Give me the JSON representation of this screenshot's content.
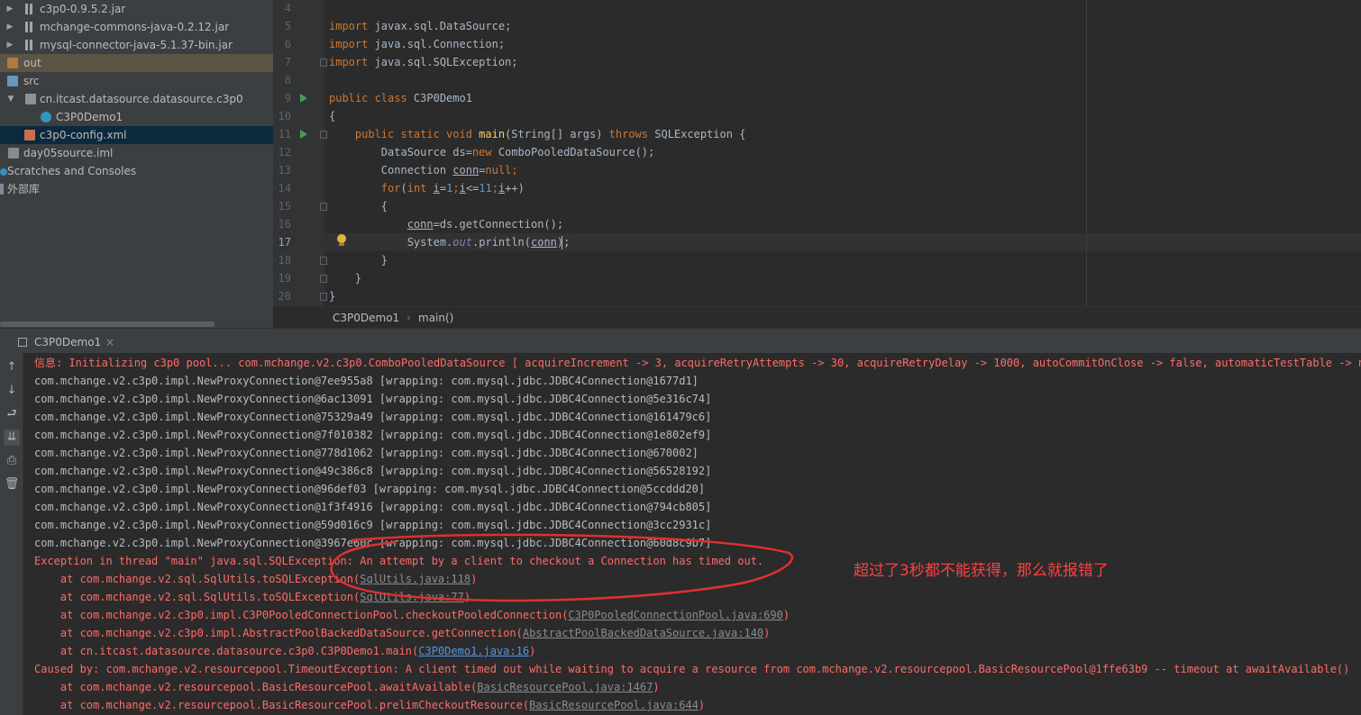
{
  "project_tree": {
    "items": [
      {
        "label": "c3p0-0.9.5.2.jar",
        "icon": "jar-icon"
      },
      {
        "label": "mchange-commons-java-0.2.12.jar",
        "icon": "jar-icon"
      },
      {
        "label": "mysql-connector-java-5.1.37-bin.jar",
        "icon": "jar-icon"
      },
      {
        "label": "out",
        "icon": "folder-icon"
      },
      {
        "label": "src",
        "icon": "folder-icon"
      },
      {
        "label": "cn.itcast.datasource.datasource.c3p0",
        "icon": "package-icon"
      },
      {
        "label": "C3P0Demo1",
        "icon": "class-icon"
      },
      {
        "label": "c3p0-config.xml",
        "icon": "xml-file-icon"
      },
      {
        "label": "day05source.iml",
        "icon": "iml-file-icon"
      },
      {
        "label": "Scratches and Consoles",
        "icon": "scratches-icon"
      },
      {
        "label": "外部库",
        "icon": "external-libraries-icon"
      }
    ]
  },
  "editor": {
    "line_numbers": [
      "4",
      "5",
      "6",
      "7",
      "8",
      "9",
      "10",
      "11",
      "12",
      "13",
      "14",
      "15",
      "16",
      "17",
      "18",
      "19",
      "20"
    ],
    "current_line": "17",
    "code": {
      "l5_kw": "import",
      "l5_rest": " javax.sql.DataSource;",
      "l6_kw": "import",
      "l6_rest": " java.sql.Connection;",
      "l7_kw": "import",
      "l7_rest": " java.sql.SQLException;",
      "l9_kw": "public class",
      "l9_rest": " C3P0Demo1",
      "l10": "{",
      "l11_kw1": "    public static void",
      "l11_fn": " main",
      "l11_mid": "(String[] args) ",
      "l11_kw2": "throws",
      "l11_rest": " SQLException {",
      "l12_a": "        DataSource ds=",
      "l12_kw": "new",
      "l12_b": " ComboPooledDataSource();",
      "l13_a": "        Connection ",
      "l13_var": "conn",
      "l13_b": "=",
      "l13_kw": "null",
      "l13_c": ";",
      "l14_ind": "        ",
      "l14_kw1": "for",
      "l14_b": "(",
      "l14_kw2": "int",
      "l14_c": " ",
      "l14_i1": "i",
      "l14_d": "=",
      "l14_n1": "1",
      "l14_e": ";",
      "l14_i2": "i",
      "l14_f": "<=",
      "l14_n2": "11",
      "l14_g": ";",
      "l14_i3": "i",
      "l14_h": "++)",
      "l15": "        {",
      "l16_ind": "            ",
      "l16_var": "conn",
      "l16_rest": "=ds.getConnection();",
      "l17_a": "            System.",
      "l17_out": "out",
      "l17_b": ".println(",
      "l17_var": "conn",
      "l17_c": ");",
      "l18": "        }",
      "l19": "    }",
      "l20": "}"
    }
  },
  "breadcrumb": {
    "class": "C3P0Demo1",
    "separator": "›",
    "method": "main()"
  },
  "run_window": {
    "tab_label": "C3P0Demo1",
    "close": "×"
  },
  "toolbar": {
    "up": "↑",
    "down": "↓",
    "wrap": "⮐",
    "scroll_end": "⇊",
    "print": "⎙",
    "trash": "🗑"
  },
  "console": {
    "info_line": "信息: Initializing c3p0 pool... com.mchange.v2.c3p0.ComboPooledDataSource [ acquireIncrement -> 3, acquireRetryAttempts -> 30, acquireRetryDelay -> 1000, autoCommitOnClose -> false, automaticTestTable -> null, b",
    "conn_lines": [
      "com.mchange.v2.c3p0.impl.NewProxyConnection@7ee955a8 [wrapping: com.mysql.jdbc.JDBC4Connection@1677d1]",
      "com.mchange.v2.c3p0.impl.NewProxyConnection@6ac13091 [wrapping: com.mysql.jdbc.JDBC4Connection@5e316c74]",
      "com.mchange.v2.c3p0.impl.NewProxyConnection@75329a49 [wrapping: com.mysql.jdbc.JDBC4Connection@161479c6]",
      "com.mchange.v2.c3p0.impl.NewProxyConnection@7f010382 [wrapping: com.mysql.jdbc.JDBC4Connection@1e802ef9]",
      "com.mchange.v2.c3p0.impl.NewProxyConnection@778d1062 [wrapping: com.mysql.jdbc.JDBC4Connection@670002]",
      "com.mchange.v2.c3p0.impl.NewProxyConnection@49c386c8 [wrapping: com.mysql.jdbc.JDBC4Connection@56528192]",
      "com.mchange.v2.c3p0.impl.NewProxyConnection@96def03 [wrapping: com.mysql.jdbc.JDBC4Connection@5ccddd20]",
      "com.mchange.v2.c3p0.impl.NewProxyConnection@1f3f4916 [wrapping: com.mysql.jdbc.JDBC4Connection@794cb805]",
      "com.mchange.v2.c3p0.impl.NewProxyConnection@59d016c9 [wrapping: com.mysql.jdbc.JDBC4Connection@3cc2931c]",
      "com.mchange.v2.c3p0.impl.NewProxyConnection@3967e60c [wrapping: com.mysql.jdbc.JDBC4Connection@60d8c9b7]"
    ],
    "exception_line": "Exception in thread \"main\" java.sql.SQLException: An attempt by a client to checkout a Connection has timed out.",
    "stack": [
      {
        "prefix": "    at com.mchange.v2.sql.SqlUtils.toSQLException(",
        "link": "SqlUtils.java:118",
        "suffix": ")"
      },
      {
        "prefix": "    at com.mchange.v2.sql.SqlUtils.toSQLException(",
        "link": "SqlUtils.java:77",
        "suffix": ")"
      },
      {
        "prefix": "    at com.mchange.v2.c3p0.impl.C3P0PooledConnectionPool.checkoutPooledConnection(",
        "link": "C3P0PooledConnectionPool.java:690",
        "suffix": ")"
      },
      {
        "prefix": "    at com.mchange.v2.c3p0.impl.AbstractPoolBackedDataSource.getConnection(",
        "link": "AbstractPoolBackedDataSource.java:140",
        "suffix": ")"
      },
      {
        "prefix": "    at cn.itcast.datasource.datasource.c3p0.C3P0Demo1.main(",
        "link": "C3P0Demo1.java:16",
        "suffix": ")"
      }
    ],
    "caused_by": "Caused by: com.mchange.v2.resourcepool.TimeoutException: A client timed out while waiting to acquire a resource from com.mchange.v2.resourcepool.BasicResourcePool@1ffe63b9 -- timeout at awaitAvailable()",
    "stack2": [
      {
        "prefix": "    at com.mchange.v2.resourcepool.BasicResourcePool.awaitAvailable(",
        "link": "BasicResourcePool.java:1467",
        "suffix": ")"
      },
      {
        "prefix": "    at com.mchange.v2.resourcepool.BasicResourcePool.prelimCheckoutResource(",
        "link": "BasicResourcePool.java:644",
        "suffix": ")"
      }
    ]
  },
  "annotation": {
    "text": "超过了3秒都不能获得，那么就报错了"
  },
  "colors": {
    "error": "#ff6b68",
    "link": "#5394ec",
    "keyword": "#cc7832",
    "annotation": "#ff4040"
  }
}
